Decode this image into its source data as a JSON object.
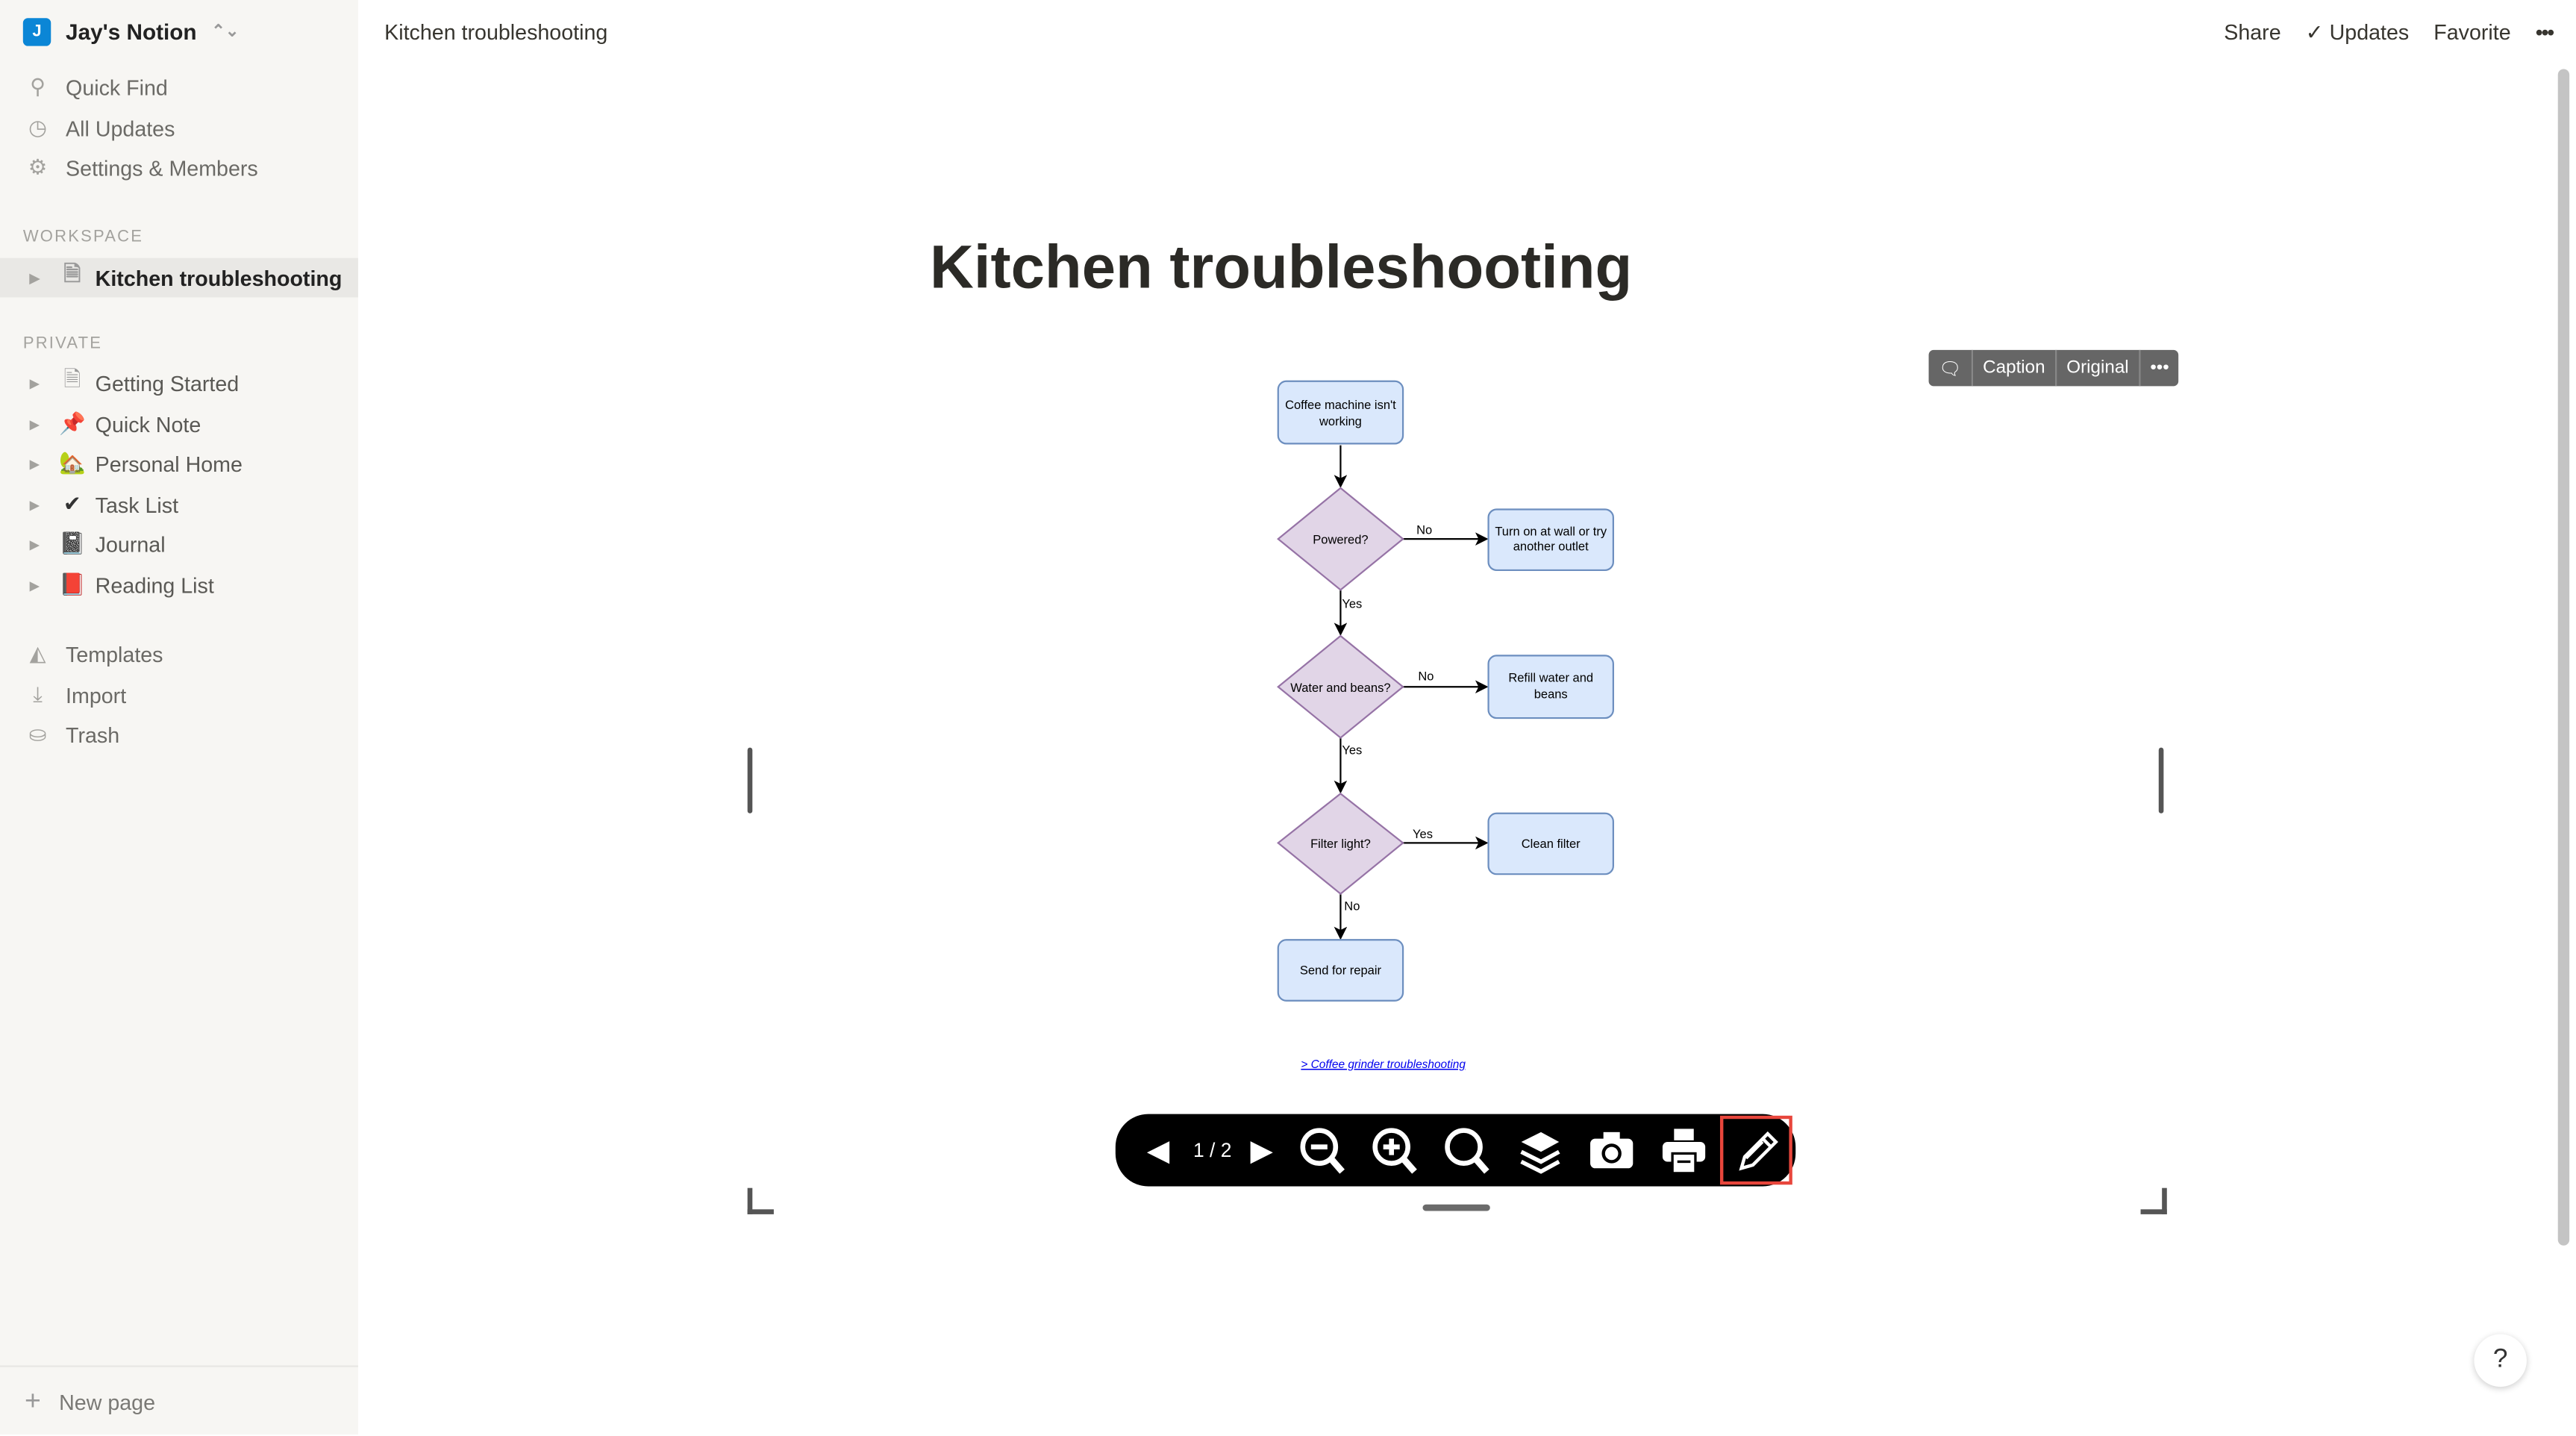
{
  "workspace": {
    "initial": "J",
    "name": "Jay's Notion"
  },
  "nav": [
    {
      "label": "Quick Find",
      "icon": "search-icon"
    },
    {
      "label": "All Updates",
      "icon": "clock-icon"
    },
    {
      "label": "Settings & Members",
      "icon": "gear-icon"
    }
  ],
  "sections": {
    "workspace": "WORKSPACE",
    "private": "PRIVATE"
  },
  "workspace_pages": [
    {
      "label": "Kitchen troubleshooting",
      "icon": "page-icon"
    }
  ],
  "private_pages": [
    {
      "label": "Getting Started",
      "icon": "page-icon",
      "glyph": "🗎"
    },
    {
      "label": "Quick Note",
      "icon": "pushpin-icon",
      "glyph": "📌"
    },
    {
      "label": "Personal Home",
      "icon": "house-icon",
      "glyph": "🏡"
    },
    {
      "label": "Task List",
      "icon": "checkmark-icon",
      "glyph": "✔"
    },
    {
      "label": "Journal",
      "icon": "notebook-icon",
      "glyph": "📓"
    },
    {
      "label": "Reading List",
      "icon": "book-icon",
      "glyph": "📕"
    }
  ],
  "tools": [
    {
      "label": "Templates",
      "icon": "templates-icon"
    },
    {
      "label": "Import",
      "icon": "download-icon"
    },
    {
      "label": "Trash",
      "icon": "trash-icon"
    }
  ],
  "new_page": "New page",
  "topbar": {
    "breadcrumb": "Kitchen troubleshooting",
    "share": "Share",
    "updates": "Updates",
    "favorite": "Favorite",
    "more": "•••"
  },
  "page_title": "Kitchen troubleshooting",
  "image_toolbar": {
    "caption": "Caption",
    "original": "Original",
    "more": "•••"
  },
  "flowchart": {
    "start": [
      "Coffee machine isn't",
      "working"
    ],
    "d1": "Powered?",
    "d1_no": "No",
    "d1_yes": "Yes",
    "a1": [
      "Turn on at wall or try",
      "another outlet"
    ],
    "d2": "Water and beans?",
    "d2_no": "No",
    "d2_yes": "Yes",
    "a2": [
      "Refill water and",
      "beans"
    ],
    "d3": "Filter light?",
    "d3_yes": "Yes",
    "d3_no": "No",
    "a3": "Clean filter",
    "end": "Send for repair",
    "link": "> Coffee grinder troubleshooting",
    "colors": {
      "box_fill": "#dae8fc",
      "box_stroke": "#6c8ebf",
      "diamond_fill": "#e1d5e7",
      "diamond_stroke": "#9673a6"
    }
  },
  "viewer": {
    "page": "1 / 2",
    "highlight_color": "#e8463c"
  },
  "help": "?"
}
